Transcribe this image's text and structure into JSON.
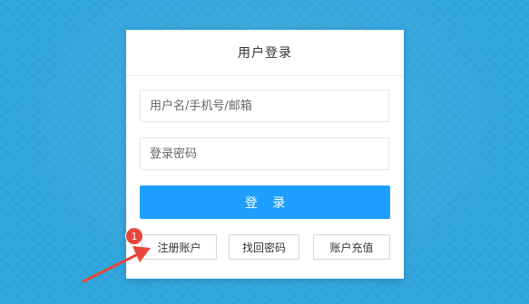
{
  "login": {
    "title": "用户登录",
    "username_placeholder": "用户名/手机号/邮箱",
    "password_placeholder": "登录密码",
    "login_button": "登 录",
    "links": {
      "register": "注册账户",
      "forgot_password": "找回密码",
      "recharge": "账户充值"
    }
  },
  "annotation": {
    "step_number": "1",
    "color": "#e8463a"
  },
  "colors": {
    "background": "#2fa4dc",
    "primary_button": "#1e9fff"
  }
}
